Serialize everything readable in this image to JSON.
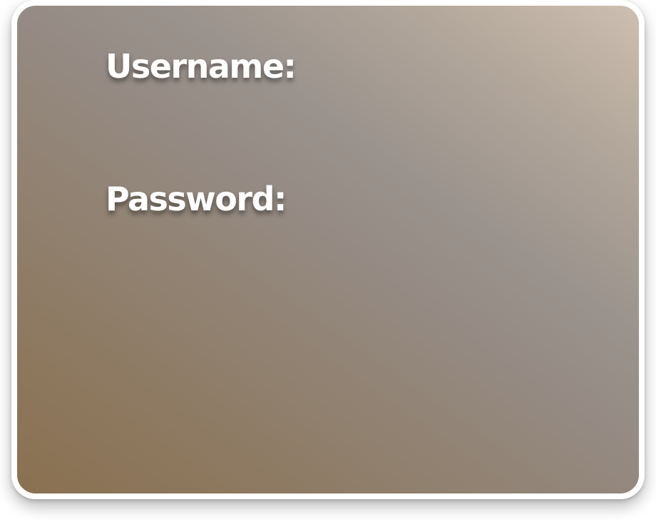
{
  "login_form": {
    "username_label": "Username:",
    "password_label": "Password:"
  }
}
